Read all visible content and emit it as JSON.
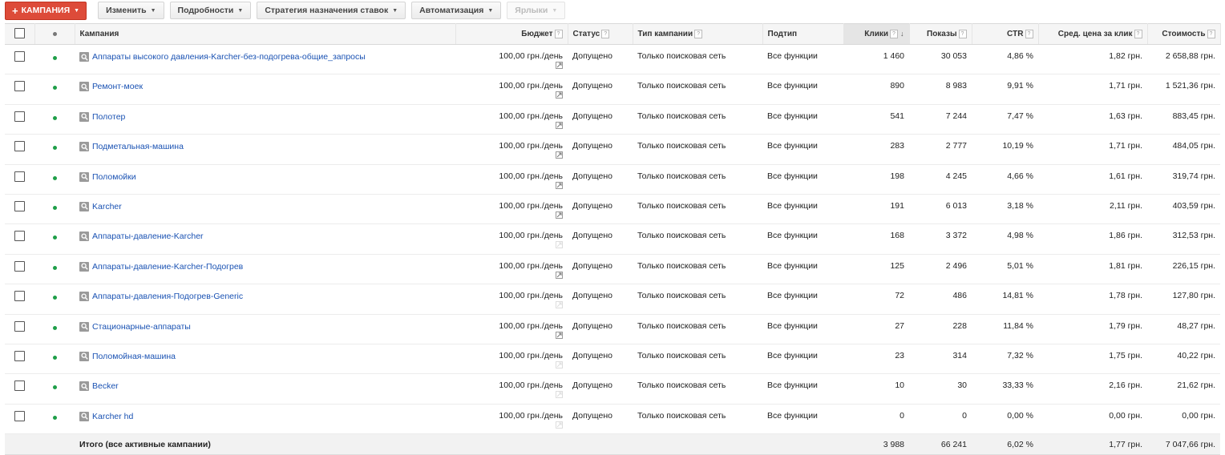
{
  "toolbar": {
    "add_campaign": "КАМПАНИЯ",
    "edit": "Изменить",
    "details": "Подробности",
    "bid_strategy": "Стратегия назначения ставок",
    "automation": "Автоматизация",
    "labels": "Ярлыки"
  },
  "columns": {
    "campaign": "Кампания",
    "budget": "Бюджет",
    "status": "Статус",
    "type": "Тип кампании",
    "subtype": "Подтип",
    "clicks": "Клики",
    "impressions": "Показы",
    "ctr": "CTR",
    "avg_cpc": "Сред. цена за клик",
    "cost": "Стоимость"
  },
  "colors": {
    "status_active": "#1e9e48",
    "link": "#1a52b3",
    "primary_button": "#dd4b39"
  },
  "rows": [
    {
      "name": "Аппараты высокого давления-Karcher-без-подогрева-общие_запросы",
      "budget": "100,00 грн./день",
      "status": "Допущено",
      "type": "Только поисковая сеть",
      "subtype": "Все функции",
      "clicks": "1 460",
      "impressions": "30 053",
      "ctr": "4,86 %",
      "avg_cpc": "1,82 грн.",
      "cost": "2 658,88 грн.",
      "trend_faint": false
    },
    {
      "name": "Ремонт-моек",
      "budget": "100,00 грн./день",
      "status": "Допущено",
      "type": "Только поисковая сеть",
      "subtype": "Все функции",
      "clicks": "890",
      "impressions": "8 983",
      "ctr": "9,91 %",
      "avg_cpc": "1,71 грн.",
      "cost": "1 521,36 грн.",
      "trend_faint": false
    },
    {
      "name": "Полотер",
      "budget": "100,00 грн./день",
      "status": "Допущено",
      "type": "Только поисковая сеть",
      "subtype": "Все функции",
      "clicks": "541",
      "impressions": "7 244",
      "ctr": "7,47 %",
      "avg_cpc": "1,63 грн.",
      "cost": "883,45 грн.",
      "trend_faint": false
    },
    {
      "name": "Подметальная-машина",
      "budget": "100,00 грн./день",
      "status": "Допущено",
      "type": "Только поисковая сеть",
      "subtype": "Все функции",
      "clicks": "283",
      "impressions": "2 777",
      "ctr": "10,19 %",
      "avg_cpc": "1,71 грн.",
      "cost": "484,05 грн.",
      "trend_faint": false
    },
    {
      "name": "Поломойки",
      "budget": "100,00 грн./день",
      "status": "Допущено",
      "type": "Только поисковая сеть",
      "subtype": "Все функции",
      "clicks": "198",
      "impressions": "4 245",
      "ctr": "4,66 %",
      "avg_cpc": "1,61 грн.",
      "cost": "319,74 грн.",
      "trend_faint": false
    },
    {
      "name": "Karcher",
      "budget": "100,00 грн./день",
      "status": "Допущено",
      "type": "Только поисковая сеть",
      "subtype": "Все функции",
      "clicks": "191",
      "impressions": "6 013",
      "ctr": "3,18 %",
      "avg_cpc": "2,11 грн.",
      "cost": "403,59 грн.",
      "trend_faint": false
    },
    {
      "name": "Аппараты-давление-Karcher",
      "budget": "100,00 грн./день",
      "status": "Допущено",
      "type": "Только поисковая сеть",
      "subtype": "Все функции",
      "clicks": "168",
      "impressions": "3 372",
      "ctr": "4,98 %",
      "avg_cpc": "1,86 грн.",
      "cost": "312,53 грн.",
      "trend_faint": true
    },
    {
      "name": "Аппараты-давление-Karcher-Подогрев",
      "budget": "100,00 грн./день",
      "status": "Допущено",
      "type": "Только поисковая сеть",
      "subtype": "Все функции",
      "clicks": "125",
      "impressions": "2 496",
      "ctr": "5,01 %",
      "avg_cpc": "1,81 грн.",
      "cost": "226,15 грн.",
      "trend_faint": false
    },
    {
      "name": "Аппараты-давления-Подогрев-Generic",
      "budget": "100,00 грн./день",
      "status": "Допущено",
      "type": "Только поисковая сеть",
      "subtype": "Все функции",
      "clicks": "72",
      "impressions": "486",
      "ctr": "14,81 %",
      "avg_cpc": "1,78 грн.",
      "cost": "127,80 грн.",
      "trend_faint": true
    },
    {
      "name": "Стационарные-аппараты",
      "budget": "100,00 грн./день",
      "status": "Допущено",
      "type": "Только поисковая сеть",
      "subtype": "Все функции",
      "clicks": "27",
      "impressions": "228",
      "ctr": "11,84 %",
      "avg_cpc": "1,79 грн.",
      "cost": "48,27 грн.",
      "trend_faint": false
    },
    {
      "name": "Поломойная-машина",
      "budget": "100,00 грн./день",
      "status": "Допущено",
      "type": "Только поисковая сеть",
      "subtype": "Все функции",
      "clicks": "23",
      "impressions": "314",
      "ctr": "7,32 %",
      "avg_cpc": "1,75 грн.",
      "cost": "40,22 грн.",
      "trend_faint": true
    },
    {
      "name": "Becker",
      "budget": "100,00 грн./день",
      "status": "Допущено",
      "type": "Только поисковая сеть",
      "subtype": "Все функции",
      "clicks": "10",
      "impressions": "30",
      "ctr": "33,33 %",
      "avg_cpc": "2,16 грн.",
      "cost": "21,62 грн.",
      "trend_faint": true
    },
    {
      "name": "Karcher hd",
      "budget": "100,00 грн./день",
      "status": "Допущено",
      "type": "Только поисковая сеть",
      "subtype": "Все функции",
      "clicks": "0",
      "impressions": "0",
      "ctr": "0,00 %",
      "avg_cpc": "0,00 грн.",
      "cost": "0,00 грн.",
      "trend_faint": true
    }
  ],
  "total": {
    "label": "Итого (все активные кампании)",
    "clicks": "3 988",
    "impressions": "66 241",
    "ctr": "6,02 %",
    "avg_cpc": "1,77 грн.",
    "cost": "7 047,66 грн."
  }
}
